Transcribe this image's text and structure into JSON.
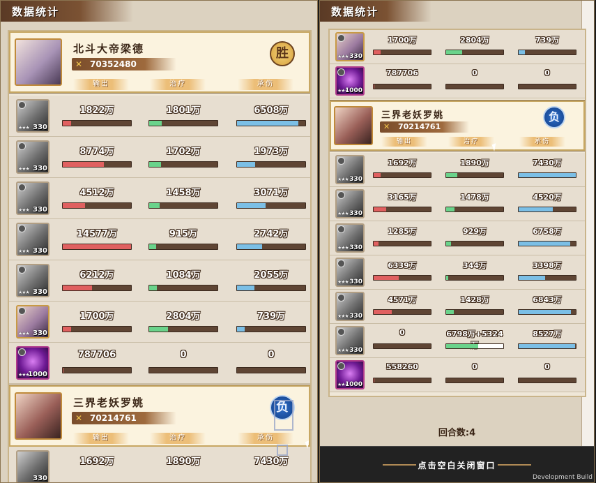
{
  "left": {
    "title": "数据统计",
    "hero_top": {
      "name": "北斗大帝梁德",
      "power": "70352480",
      "result": "胜",
      "tabs": [
        "输出",
        "治疗",
        "承伤"
      ]
    },
    "rows": [
      {
        "level": "330",
        "kind": "gray",
        "out": "1822万",
        "heal": "1801万",
        "tank": "6508万",
        "out_pct": 0.12,
        "heal_pct": 0.18,
        "tank_pct": 0.9
      },
      {
        "level": "330",
        "kind": "gray",
        "out": "8774万",
        "heal": "1702万",
        "tank": "1973万",
        "out_pct": 0.6,
        "heal_pct": 0.17,
        "tank_pct": 0.27
      },
      {
        "level": "330",
        "kind": "gray",
        "out": "4512万",
        "heal": "1458万",
        "tank": "3071万",
        "out_pct": 0.33,
        "heal_pct": 0.15,
        "tank_pct": 0.42
      },
      {
        "level": "330",
        "kind": "gray",
        "out": "14577万",
        "heal": "915万",
        "tank": "2742万",
        "out_pct": 1.0,
        "heal_pct": 0.1,
        "tank_pct": 0.37
      },
      {
        "level": "330",
        "kind": "gray",
        "out": "6212万",
        "heal": "1084万",
        "tank": "2055万",
        "out_pct": 0.43,
        "heal_pct": 0.11,
        "tank_pct": 0.26
      },
      {
        "level": "330",
        "kind": "color",
        "out": "1700万",
        "heal": "2804万",
        "tank": "739万",
        "out_pct": 0.12,
        "heal_pct": 0.28,
        "tank_pct": 0.11
      },
      {
        "level": "1000",
        "kind": "purple",
        "out": "787706",
        "heal": "0",
        "tank": "0",
        "out_pct": 0.01,
        "heal_pct": 0,
        "tank_pct": 0
      }
    ],
    "hero_bottom": {
      "name": "三界老妖罗姚",
      "power": "70214761",
      "result": "负",
      "tabs": [
        "输出",
        "治疗",
        "承伤"
      ]
    },
    "partial_row": {
      "level": "330",
      "out": "1692万",
      "heal": "1890万",
      "tank": "7430万"
    }
  },
  "right": {
    "title": "数据统计",
    "rows_top": [
      {
        "level": "330",
        "kind": "color",
        "out": "1700万",
        "heal": "2804万",
        "tank": "739万",
        "out_pct": 0.12,
        "heal_pct": 0.28,
        "tank_pct": 0.11
      },
      {
        "level": "1000",
        "kind": "purple",
        "out": "787706",
        "heal": "0",
        "tank": "0",
        "out_pct": 0.01,
        "heal_pct": 0,
        "tank_pct": 0
      }
    ],
    "hero": {
      "name": "三界老妖罗姚",
      "power": "70214761",
      "result": "负",
      "tabs": [
        "输出",
        "治疗",
        "承伤"
      ]
    },
    "rows_bottom": [
      {
        "level": "330",
        "kind": "gray",
        "out": "1692万",
        "heal": "1890万",
        "tank": "7430万",
        "out_pct": 0.12,
        "heal_pct": 0.19,
        "tank_pct": 1.0
      },
      {
        "level": "330",
        "kind": "gray",
        "out": "3165万",
        "heal": "1478万",
        "tank": "4520万",
        "out_pct": 0.22,
        "heal_pct": 0.15,
        "tank_pct": 0.6
      },
      {
        "level": "330",
        "kind": "gray",
        "out": "1285万",
        "heal": "929万",
        "tank": "6758万",
        "out_pct": 0.09,
        "heal_pct": 0.09,
        "tank_pct": 0.9
      },
      {
        "level": "330",
        "kind": "gray",
        "out": "6339万",
        "heal": "344万",
        "tank": "3398万",
        "out_pct": 0.44,
        "heal_pct": 0.04,
        "tank_pct": 0.46
      },
      {
        "level": "330",
        "kind": "gray",
        "out": "4571万",
        "heal": "1428万",
        "tank": "6843万",
        "out_pct": 0.32,
        "heal_pct": 0.14,
        "tank_pct": 0.92
      },
      {
        "level": "330",
        "kind": "gray",
        "out": "0",
        "heal": "6798万+5324万",
        "tank": "8527万",
        "out_pct": 0,
        "heal_pct": 0.56,
        "heal_extra_pct": 0.44,
        "tank_pct": 0.99
      },
      {
        "level": "1000",
        "kind": "purple",
        "out": "558260",
        "heal": "0",
        "tank": "0",
        "out_pct": 0.01,
        "heal_pct": 0,
        "tank_pct": 0
      }
    ],
    "rounds": "回合数:4",
    "close_hint": "点击空白关闭窗口",
    "build_tag": "Development Build"
  }
}
